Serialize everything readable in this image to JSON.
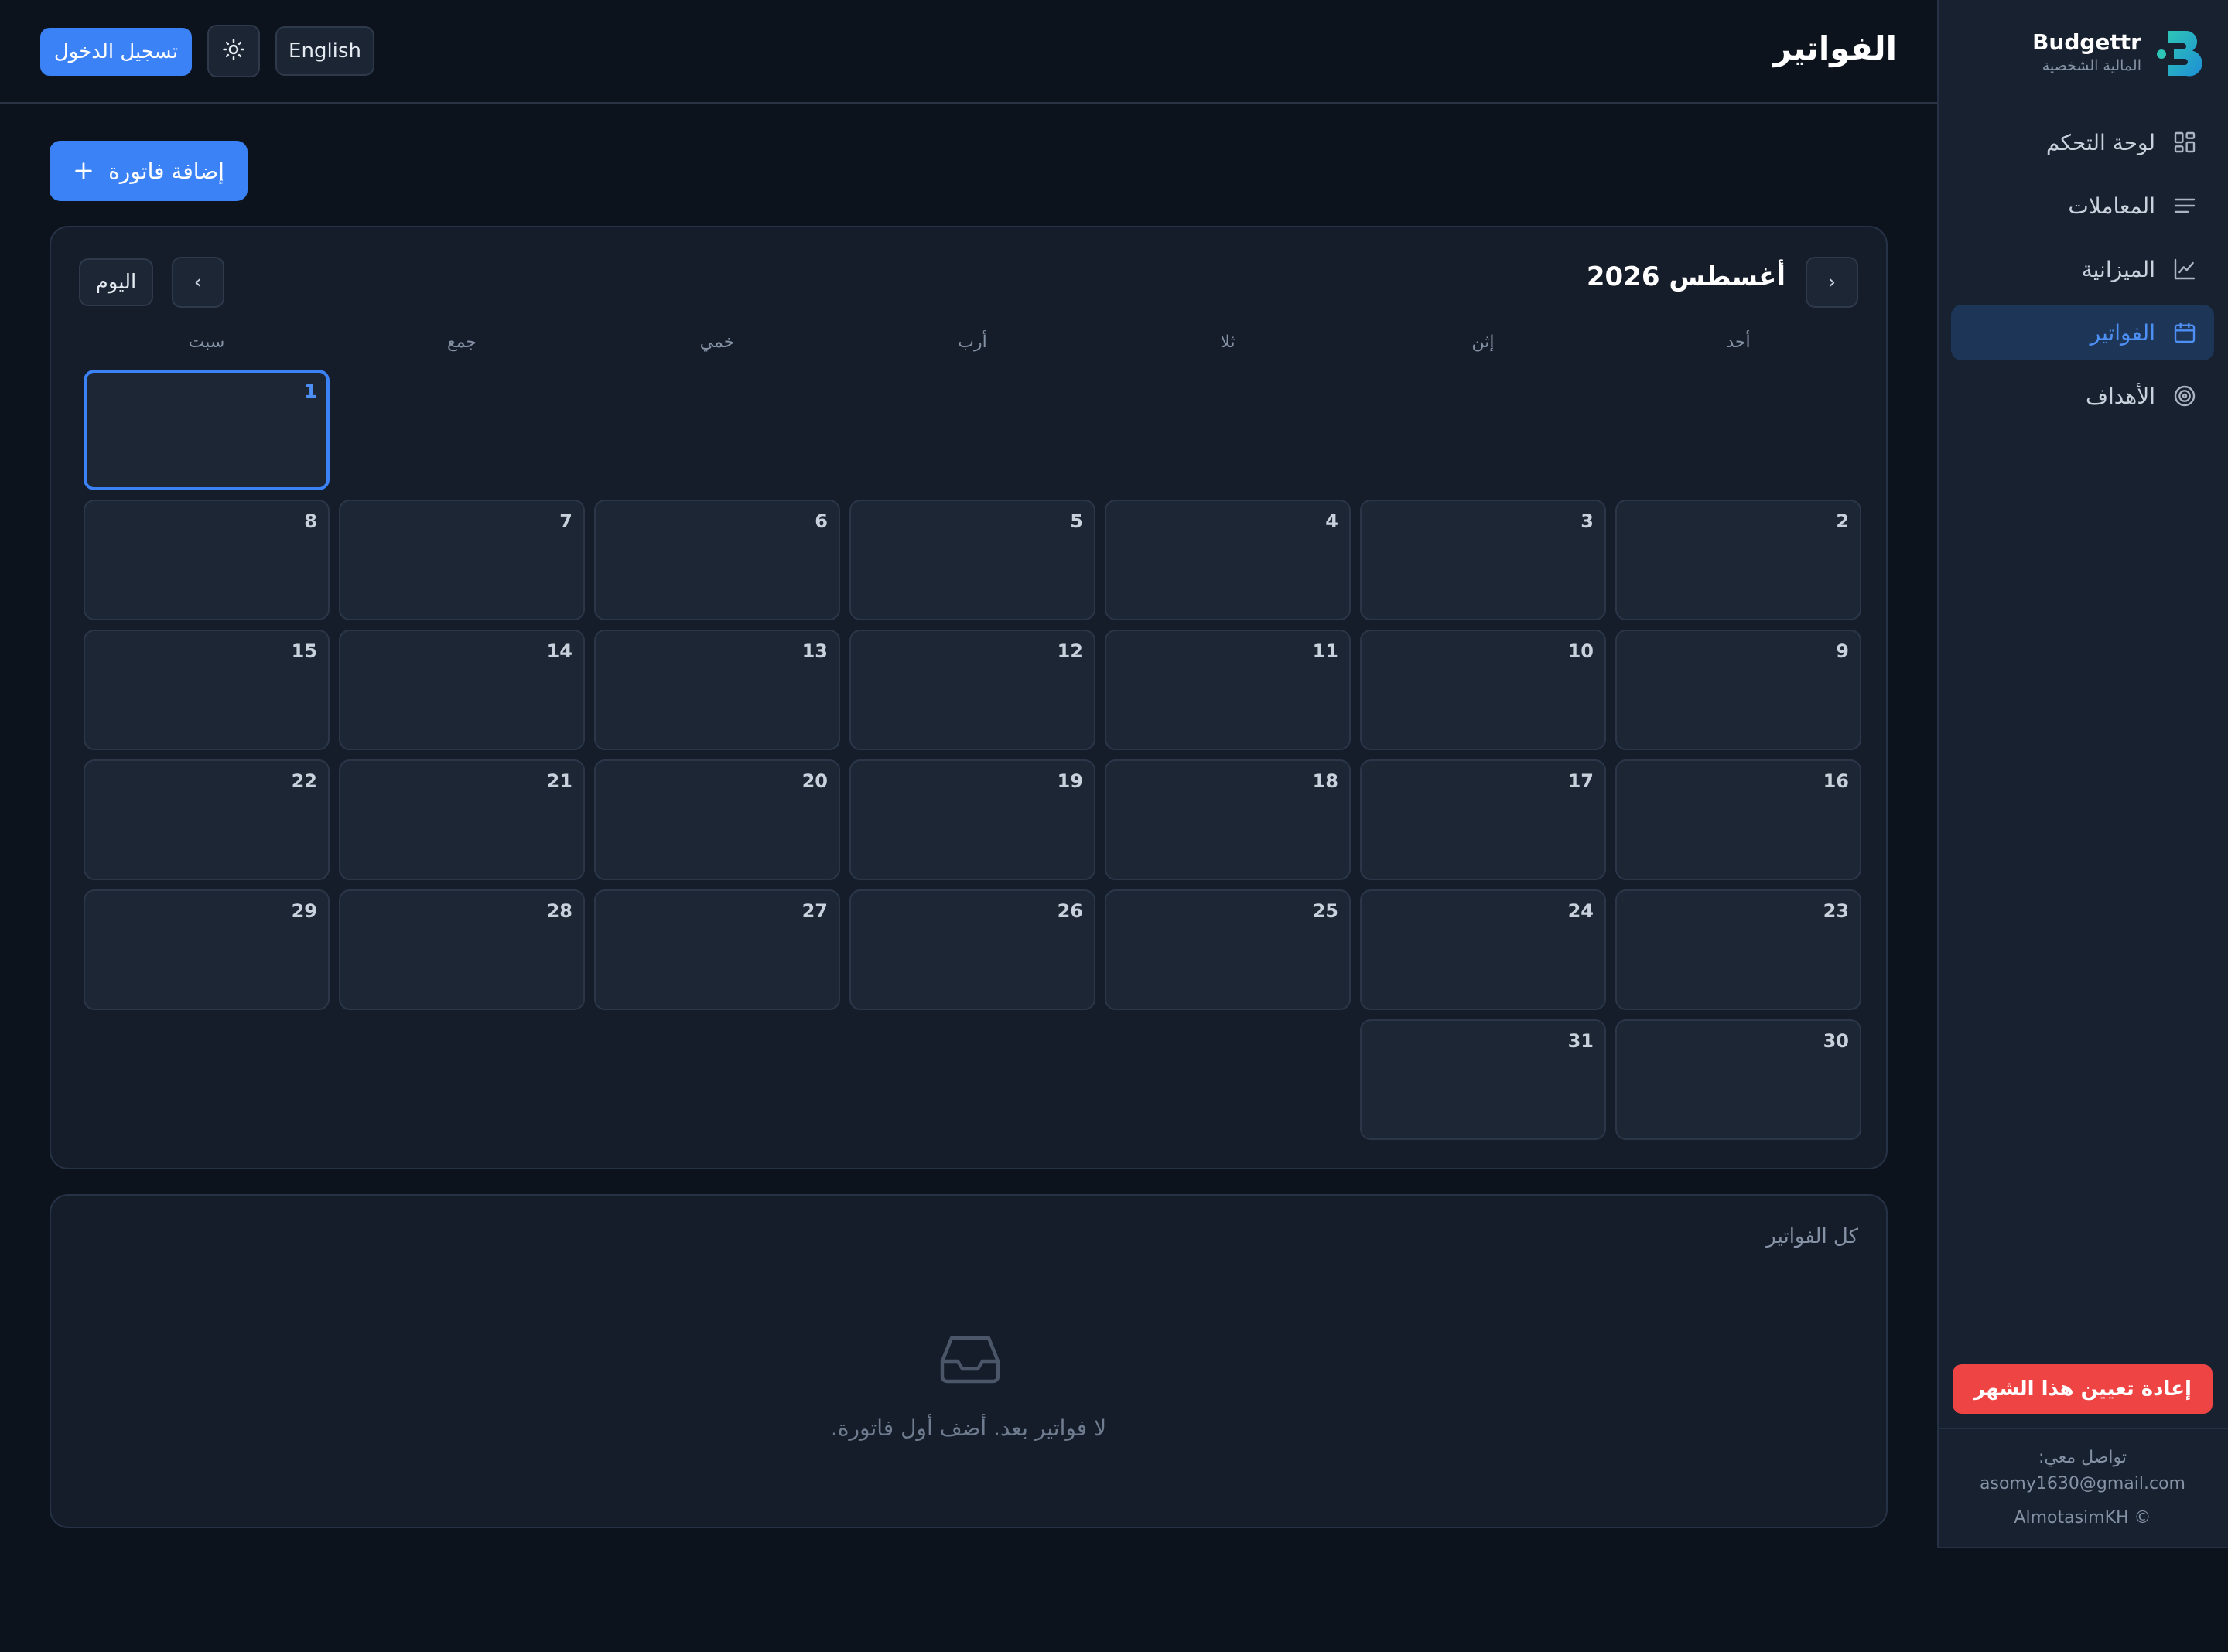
{
  "app": {
    "name": "Budgettr",
    "subtitle": "المالية الشخصية"
  },
  "header": {
    "title": "الفواتير",
    "login_label": "تسجيل الدخول",
    "language_label": "English",
    "theme_icon": "sun-icon"
  },
  "sidebar": {
    "items": [
      {
        "label": "لوحة التحكم",
        "icon": "dashboard-grid-icon",
        "active": false
      },
      {
        "label": "المعاملات",
        "icon": "list-lines-icon",
        "active": false
      },
      {
        "label": "الميزانية",
        "icon": "line-chart-icon",
        "active": false
      },
      {
        "label": "الفواتير",
        "icon": "calendar-icon",
        "active": true
      },
      {
        "label": "الأهداف",
        "icon": "target-icon",
        "active": false
      }
    ],
    "reset_label": "إعادة تعيين هذا الشهر",
    "footer": {
      "contact_label": "تواصل معي:",
      "email": "asomy1630@gmail.com",
      "copyright": "AlmotasimKH ©"
    }
  },
  "main": {
    "add_bill_label": "إضافة فاتورة",
    "calendar": {
      "month_title": "أغسطس 2026",
      "today_label": "اليوم",
      "next_symbol": "›",
      "prev_symbol": "‹",
      "weekdays": [
        "أحد",
        "إثن",
        "ثلا",
        "أرب",
        "خمي",
        "جمع",
        "سبت"
      ],
      "first_weekday_index": 6,
      "days_in_month": 31,
      "today": 1
    },
    "bills": {
      "title": "كل الفواتير",
      "empty_text": "لا فواتير بعد. أضف أول فاتورة.",
      "empty_icon": "inbox-tray-icon"
    }
  },
  "colors": {
    "accent": "#3b82f6",
    "danger": "#ee4444",
    "background": "#0d131c",
    "surface": "#151d2a",
    "sidebar": "#172130",
    "brand_teal": "#2ec4b6"
  }
}
